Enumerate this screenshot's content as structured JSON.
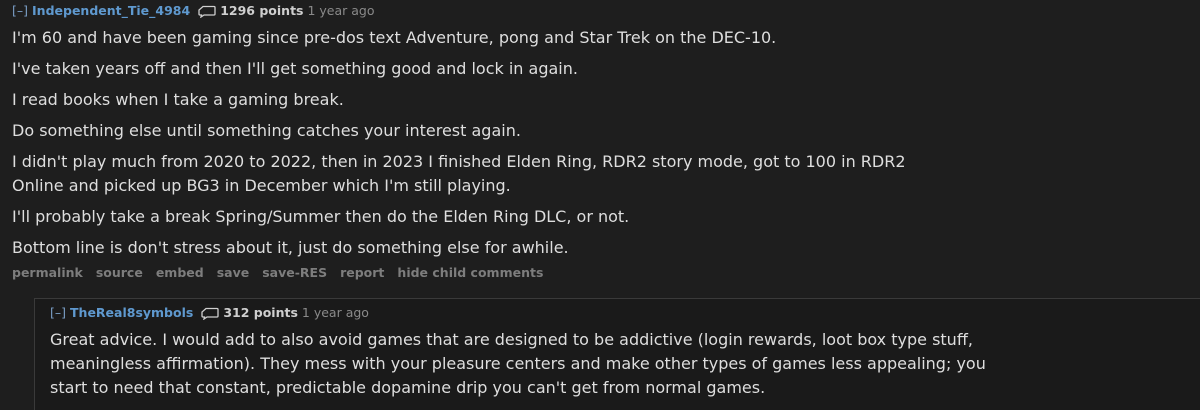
{
  "comments": [
    {
      "expand_label": "[–]",
      "author": "Independent_Tie_4984",
      "score": "1296 points",
      "time": "1 year ago",
      "paragraphs": [
        "I'm 60 and have been gaming since pre-dos text Adventure, pong and Star Trek on the DEC-10.",
        "I've taken years off and then I'll get something good and lock in again.",
        "I read books when I take a gaming break.",
        "Do something else until something catches your interest again.",
        "I didn't play much from 2020 to 2022, then in 2023 I finished Elden Ring, RDR2 story mode, got to 100 in RDR2",
        "Online and picked up BG3 in December which I'm still playing.",
        "I'll probably take a break Spring/Summer then do the Elden Ring DLC, or not.",
        "Bottom line is don't stress about it, just do something else for awhile."
      ],
      "buttons": [
        "permalink",
        "source",
        "embed",
        "save",
        "save-RES",
        "report",
        "hide child comments"
      ]
    },
    {
      "expand_label": "[–]",
      "author": "TheReal8symbols",
      "score": "312 points",
      "time": "1 year ago",
      "paragraphs": [
        "Great advice. I would add to also avoid games that are designed to be addictive (login rewards, loot box type stuff,",
        "meaningless affirmation). They mess with your pleasure centers and make other types of games less appealing; you",
        "start to need that constant, predictable dopamine drip you can't get from normal games."
      ]
    }
  ],
  "colors": {
    "background": "#1e1e1e",
    "author": "#5f99cf",
    "text": "#dedede",
    "muted": "#7d7d7d"
  },
  "icons": {
    "score": "speech-bubble-icon"
  }
}
